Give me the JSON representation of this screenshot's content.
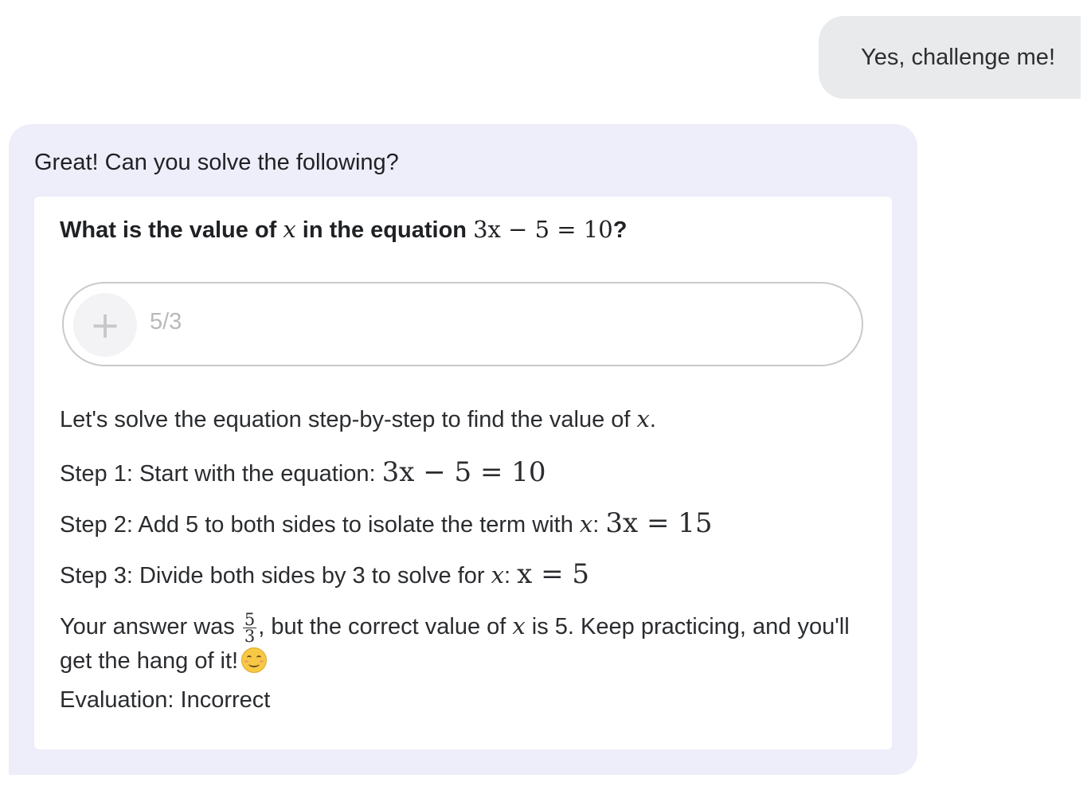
{
  "user_message": {
    "text": "Yes, challenge me!"
  },
  "assistant_message": {
    "intro": "Great! Can you solve the following?",
    "question": {
      "prefix": "What is the value of ",
      "variable": "x",
      "middle": " in the equation ",
      "equation": "3x − 5 = 10",
      "suffix": "?"
    },
    "answer_input": {
      "value": "5/3",
      "attach_icon": "plus-icon"
    },
    "explanation": {
      "intro_text": "Let's solve the equation step-by-step to find the value of ",
      "intro_var": "x",
      "intro_end": ".",
      "step1_text": "Step 1: Start with the equation: ",
      "step1_math": "3x − 5 = 10",
      "step2_text": "Step 2: Add 5 to both sides to isolate the term with ",
      "step2_var": "x",
      "step2_colon": ": ",
      "step2_math": "3x = 15",
      "step3_text": "Step 3: Divide both sides by 3 to solve for ",
      "step3_var": "x",
      "step3_colon": ": ",
      "step3_math": "x = 5",
      "feedback_pre": "Your answer was ",
      "feedback_frac_num": "5",
      "feedback_frac_den": "3",
      "feedback_mid": ", but the correct value of ",
      "feedback_var": "x",
      "feedback_end": " is 5. Keep practicing, and you'll get the hang of it!",
      "feedback_emoji": "smiling-face-icon",
      "evaluation": "Evaluation: Incorrect"
    }
  },
  "colors": {
    "user_bubble": "#e8eaeb",
    "assistant_bubble": "#eeedfa",
    "card": "#ffffff"
  }
}
